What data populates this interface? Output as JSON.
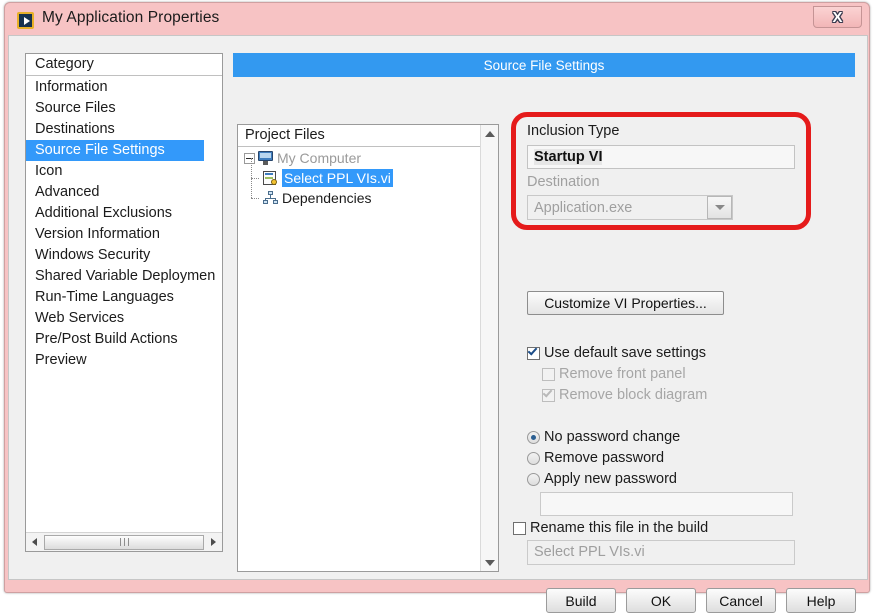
{
  "window": {
    "title": "My Application Properties",
    "app_icon": "labview-vi-icon",
    "close_label": "X"
  },
  "category": {
    "header": "Category",
    "items": [
      {
        "label": "Information",
        "selected": false
      },
      {
        "label": "Source Files",
        "selected": false
      },
      {
        "label": "Destinations",
        "selected": false
      },
      {
        "label": "Source File Settings",
        "selected": true
      },
      {
        "label": "Icon",
        "selected": false
      },
      {
        "label": "Advanced",
        "selected": false
      },
      {
        "label": "Additional Exclusions",
        "selected": false
      },
      {
        "label": "Version Information",
        "selected": false
      },
      {
        "label": "Windows Security",
        "selected": false
      },
      {
        "label": "Shared Variable Deploymen",
        "selected": false
      },
      {
        "label": "Run-Time Languages",
        "selected": false
      },
      {
        "label": "Web Services",
        "selected": false
      },
      {
        "label": "Pre/Post Build Actions",
        "selected": false
      },
      {
        "label": "Preview",
        "selected": false
      }
    ]
  },
  "settings_header": "Source File Settings",
  "tree": {
    "header": "Project Files",
    "nodes": [
      {
        "label": "My Computer",
        "icon": "computer-icon",
        "state": "muted"
      },
      {
        "label": "Select PPL VIs.vi",
        "icon": "vi-file-icon",
        "state": "selected"
      },
      {
        "label": "Dependencies",
        "icon": "dependencies-icon",
        "state": "normal"
      }
    ]
  },
  "inclusion": {
    "label": "Inclusion Type",
    "value": "Startup VI",
    "destination_label": "Destination",
    "destination_value": "Application.exe"
  },
  "customize_button": "Customize VI Properties...",
  "save_settings": {
    "use_default": {
      "label": "Use default save settings",
      "checked": true,
      "enabled": true
    },
    "remove_front_panel": {
      "label": "Remove front panel",
      "checked": false,
      "enabled": false
    },
    "remove_block_diagram": {
      "label": "Remove block diagram",
      "checked": true,
      "enabled": false
    }
  },
  "password": {
    "options": [
      {
        "label": "No password change",
        "selected": true
      },
      {
        "label": "Remove password",
        "selected": false
      },
      {
        "label": "Apply new password",
        "selected": false
      }
    ],
    "field_value": ""
  },
  "rename": {
    "label": "Rename this file in the build",
    "checked": false,
    "field_value": "Select PPL VIs.vi"
  },
  "buttons": {
    "build": "Build",
    "ok": "OK",
    "cancel": "Cancel",
    "help": "Help"
  },
  "colors": {
    "titlebar": "#f7c3c4",
    "header_blue": "#3399f0",
    "selection_blue": "#3399fa",
    "annotation_red": "#e51b1b",
    "dialog_bg": "#f0f0f0"
  }
}
